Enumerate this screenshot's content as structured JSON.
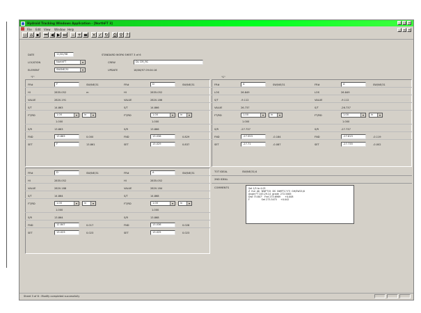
{
  "app": {
    "title": "Hydroid Tracking Windows Application - [NorthFT 3]",
    "menu": [
      "File",
      "Edit",
      "View",
      "Window",
      "Help"
    ]
  },
  "toolbar": {
    "buttons": [
      "new-icon",
      "open-icon",
      "save-icon",
      "first-icon",
      "prev-icon",
      "next-icon",
      "last-icon",
      "minus-icon",
      "plus-icon",
      "delete-icon",
      "cancel-icon",
      "check-icon",
      "refresh-icon",
      "print-icon",
      "find-icon",
      "help-icon"
    ]
  },
  "header": {
    "date_label": "DATE",
    "date_value": "11/02/98",
    "title": "STANDARD WORK SHEET 3 of 6",
    "location_label": "LOCATION",
    "location_value": "NorthFT",
    "crew_label": "CREW",
    "crew_value": "DL CM_RC",
    "element_label": "ELEMENT",
    "element_value": "SW/NE/31",
    "update_label": "UPDATE",
    "update_value": "18/06/97 09:04:16"
  },
  "sections": {
    "left": "\"T\"",
    "right": "\"C\""
  },
  "blocks": [
    {
      "id": "a",
      "fr_label": "FR#",
      "fr_value": "F",
      "fr_tag": "SW/NE/31",
      "hi_label": "HI",
      "hi_value": "2835.052",
      "hi_unit": "m",
      "value_label": "VALUE",
      "value_value": "2820.191",
      "st_label": "S/T",
      "st_value": "14.863",
      "ftrd_label": "FT/RD",
      "ftrd_value": "1.00",
      "ftrd_unit": "in",
      "ftrd_sub": "1.000",
      "sr_label": "S/R",
      "sr_value": "13.863",
      "fnd_label": "FND",
      "fnd_value": "13.863",
      "fnd_diff": "0.000",
      "set_label": "SET",
      "set_value": "F",
      "set_diff": "13.861"
    },
    {
      "id": "b",
      "fr_label": "FR#",
      "fr_value": "D",
      "fr_tag": "SW/NE/31",
      "hi_label": "HI",
      "hi_value": "2835.052",
      "value_label": "VALUE",
      "value_value": "2820.186",
      "st_label": "S/T",
      "st_value": "14.866",
      "ftrd_label": "FT/RD",
      "ftrd_value": "1.00",
      "ftrd_unit": "in",
      "ftrd_sub": "1.000",
      "sr_label": "S/R",
      "sr_value": "13.866",
      "fnd_label": "FND",
      "fnd_value": "13.036",
      "fnd_diff": "0.829",
      "set_label": "SET",
      "set_value": "13.029",
      "set_diff": "0.837"
    },
    {
      "id": "c",
      "fr_label": "FR#",
      "fr_value": "A",
      "fr_tag": "SW/NE/31",
      "los_label": "LOS",
      "los_value": "26.849",
      "st_label": "S/T",
      "st_value": "-9.112",
      "value_label": "VALUE",
      "value_value": "26.737",
      "ftrd_label": "FT/RD",
      "ftrd_value": "1.00",
      "ftrd_unit": "in",
      "ftrd_sub": "1.000",
      "sr_label": "S/R",
      "sr_value": "-27.737",
      "fnd_label": "FND",
      "fnd_value": "-27.553",
      "fnd_diff": "-0.184",
      "set_label": "SET",
      "set_value": "-27.71",
      "set_diff": "-0.087"
    },
    {
      "id": "d",
      "fr_label": "FR#",
      "fr_value": "A",
      "fr_tag": "SW/NE/31",
      "los_label": "LOS",
      "los_value": "26.849",
      "st_label": "VALUE",
      "st_value": "-9.112",
      "value_label": "S/T",
      "value_value": "-26.737",
      "ftrd_label": "FT/RD",
      "ftrd_value": "1.00",
      "ftrd_unit": "in",
      "ftrd_sub": "1.000",
      "sr_label": "S/R",
      "sr_value": "-27.737",
      "fnd_label": "FND",
      "fnd_value": "-27.615",
      "fnd_diff": "-0.119",
      "set_label": "SET",
      "set_value": "-27.735",
      "set_diff": "-0.002"
    },
    {
      "id": "e",
      "fr_label": "FR#",
      "fr_value": "D",
      "fr_tag": "SW/NE/31",
      "hi_label": "HI",
      "hi_value": "2835.052",
      "value_label": "VALUE",
      "value_value": "2820.188",
      "st_label": "S/T",
      "st_value": "14.864",
      "ftrd_label": "FT/RD",
      "ftrd_value": "1.00",
      "ftrd_unit": "in",
      "ftrd_sub": "1.000",
      "sr_label": "S/R",
      "sr_value": "13.864",
      "fnd_label": "FND",
      "fnd_value": "12.847",
      "fnd_diff": "0.017",
      "set_label": "SET",
      "set_value": "13.023",
      "set_diff": "0.023"
    },
    {
      "id": "f",
      "fr_label": "FR#",
      "fr_value": "A",
      "fr_tag": "SW/NE/31",
      "hi_label": "HI",
      "hi_value": "2835.052",
      "value_label": "VALUE",
      "value_value": "2820.184",
      "st_label": "S/T",
      "st_value": "14.868",
      "ftrd_label": "FT/RD",
      "ftrd_value": "1.00",
      "ftrd_unit": "in",
      "ftrd_sub": "1.000",
      "sr_label": "S/R",
      "sr_value": "13.868",
      "fnd_label": "FND",
      "fnd_value": "13.036",
      "fnd_diff": "0.028",
      "set_label": "SET",
      "set_value": "13.025",
      "set_diff": "0.023"
    }
  ],
  "tot": {
    "tot_ideal_label": "TOT IDEAL",
    "tot_ideal_value": "SW/NE/31/4",
    "ideal2_label": "2ND IDEAL"
  },
  "comments": {
    "label": "COMMENTS",
    "lines": [
      "Set 1/5 to 4.03",
      "Z  fnd  dtr  NWFT15  DS  NWFT17.F3  GH/SW21/0",
      "Angle FT 245.29.14  grade  272.5465",
      "Dist 75.807'   Fnd 273.6989      +0.008",
      "F                Set 273.5475     +0.042"
    ]
  },
  "status": {
    "text": "Sheet 3 of 6 : Modify completed successfully"
  }
}
